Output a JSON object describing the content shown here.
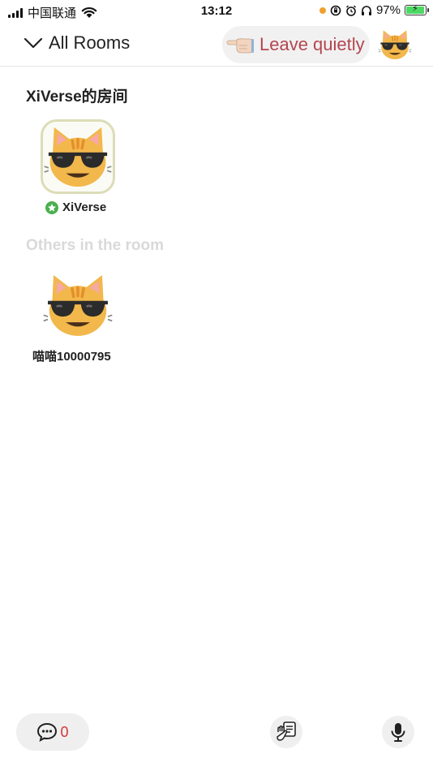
{
  "status_bar": {
    "carrier": "中国联通",
    "time": "13:12",
    "battery_percent": "97%",
    "battery_level": 0.97
  },
  "header": {
    "rooms_label": "All Rooms",
    "leave_label": "Leave quietly"
  },
  "host_section": {
    "title": "XiVerse的房间",
    "host_name": "XiVerse"
  },
  "others_section": {
    "title": "Others in the room",
    "members": [
      {
        "name": "喵喵10000795"
      }
    ]
  },
  "bottom_bar": {
    "chat_count": "0"
  },
  "colors": {
    "accent_red": "#b4464f",
    "badge_green": "#4caf50",
    "count_red": "#d83535"
  },
  "icons": {
    "avatar": "cool-cat-sunglasses",
    "leave": "hand-pointing-left",
    "chat": "chat-bubble",
    "raise_hand": "hand-with-card",
    "mic": "microphone"
  }
}
